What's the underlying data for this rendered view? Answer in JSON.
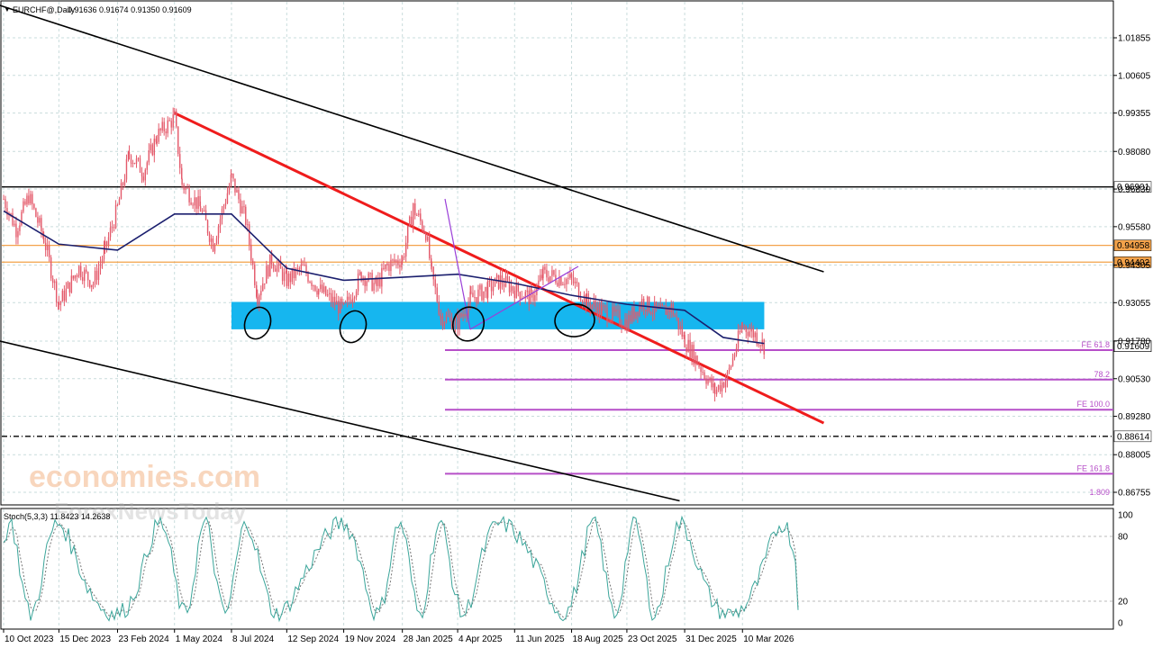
{
  "header": {
    "symbol": "EURCHF@,Daily",
    "ohlc": "0.91636 0.91674 0.91350 0.91609"
  },
  "osc_header": {
    "label": "Stoch(5,3,3) 11.8423 14.2638"
  },
  "watermark": {
    "brand": "economies.com",
    "sub": "ForexNewsToday"
  },
  "colors": {
    "candles": "#e45a6b",
    "ma": "#1b1f6e",
    "red_trend": "#ef1c1c",
    "channel": "#000000",
    "orange": "#f3a24a",
    "fib": "#b64fc8",
    "zone": "#16b6ef",
    "stoch_main": "#3aa59a",
    "stoch_signal": "#777777",
    "grid": "#c9dcdc",
    "price_tag_bg": "#000000"
  },
  "chart_data": {
    "type": "candlestick",
    "symbol": "EURCHF",
    "timeframe": "Daily",
    "price_axis": {
      "ticks": [
        "1.01855",
        "1.00605",
        "0.99355",
        "0.98080",
        "0.96830",
        "0.95580",
        "0.94305",
        "0.93055",
        "0.91780",
        "0.90530",
        "0.89280",
        "0.88005",
        "0.86755"
      ]
    },
    "time_axis": {
      "ticks": [
        "10 Oct 2023",
        "15 Dec 2023",
        "23 Feb 2024",
        "1 May 2024",
        "8 Jul 2024",
        "12 Sep 2024",
        "19 Nov 2024",
        "28 Jan 2025",
        "4 Apr 2025",
        "11 Jun 2025",
        "18 Aug 2025",
        "23 Oct 2025",
        "31 Dec 2025",
        "10 Mar 2026"
      ]
    },
    "price_series": [
      [
        "10 Oct 2023",
        0.965
      ],
      [
        "25 Oct 2023",
        0.955
      ],
      [
        "9 Nov 2023",
        0.966
      ],
      [
        "27 Nov 2023",
        0.952
      ],
      [
        "15 Dec 2023",
        0.93
      ],
      [
        "8 Jan 2024",
        0.942
      ],
      [
        "25 Jan 2024",
        0.937
      ],
      [
        "8 Feb 2024",
        0.948
      ],
      [
        "23 Feb 2024",
        0.962
      ],
      [
        "8 Mar 2024",
        0.98
      ],
      [
        "25 Mar 2024",
        0.974
      ],
      [
        "10 Apr 2024",
        0.986
      ],
      [
        "1 May 2024",
        0.992
      ],
      [
        "10 May 2024",
        0.97
      ],
      [
        "1 Jun 2024",
        0.962
      ],
      [
        "16 Jun 2024",
        0.95
      ],
      [
        "1 Jul 2024",
        0.965
      ],
      [
        "8 Jul 2024",
        0.972
      ],
      [
        "25 Jul 2024",
        0.958
      ],
      [
        "8 Aug 2024",
        0.933
      ],
      [
        "25 Aug 2024",
        0.945
      ],
      [
        "12 Sep 2024",
        0.938
      ],
      [
        "1 Oct 2024",
        0.942
      ],
      [
        "20 Oct 2024",
        0.935
      ],
      [
        "19 Nov 2024",
        0.928
      ],
      [
        "10 Dec 2024",
        0.94
      ],
      [
        "28 Dec 2024",
        0.936
      ],
      [
        "10 Jan 2025",
        0.943
      ],
      [
        "28 Jan 2025",
        0.945
      ],
      [
        "10 Feb 2025",
        0.962
      ],
      [
        "25 Feb 2025",
        0.954
      ],
      [
        "4 Mar 2025",
        0.94
      ],
      [
        "15 Mar 2025",
        0.926
      ],
      [
        "4 Apr 2025",
        0.924
      ],
      [
        "20 Apr 2025",
        0.932
      ],
      [
        "10 May 2025",
        0.935
      ],
      [
        "25 May 2025",
        0.938
      ],
      [
        "11 Jun 2025",
        0.935
      ],
      [
        "1 Jul 2025",
        0.932
      ],
      [
        "15 Jul 2025",
        0.94
      ],
      [
        "18 Aug 2025",
        0.938
      ],
      [
        "5 Sep 2025",
        0.931
      ],
      [
        "23 Sep 2025",
        0.928
      ],
      [
        "23 Oct 2025",
        0.924
      ],
      [
        "10 Nov 2025",
        0.931
      ],
      [
        "30 Nov 2025",
        0.927
      ],
      [
        "15 Dec 2025",
        0.929
      ],
      [
        "31 Dec 2025",
        0.918
      ],
      [
        "15 Jan 2026",
        0.911
      ],
      [
        "5 Feb 2026",
        0.901
      ],
      [
        "20 Feb 2026",
        0.906
      ],
      [
        "10 Mar 2026",
        0.923
      ],
      [
        "25 Mar 2026",
        0.92
      ],
      [
        "5 Apr 2026",
        0.9161
      ]
    ],
    "moving_average": [
      [
        "10 Oct 2023",
        0.961
      ],
      [
        "15 Dec 2023",
        0.95
      ],
      [
        "23 Feb 2024",
        0.948
      ],
      [
        "1 May 2024",
        0.96
      ],
      [
        "8 Jul 2024",
        0.96
      ],
      [
        "12 Sep 2024",
        0.942
      ],
      [
        "19 Nov 2024",
        0.938
      ],
      [
        "28 Jan 2025",
        0.939
      ],
      [
        "4 Apr 2025",
        0.94
      ],
      [
        "11 Jun 2025",
        0.937
      ],
      [
        "18 Aug 2025",
        0.933
      ],
      [
        "23 Oct 2025",
        0.93
      ],
      [
        "31 Dec 2025",
        0.928
      ],
      [
        "15 Feb 2026",
        0.919
      ],
      [
        "10 Mar 2026",
        0.918
      ],
      [
        "5 Apr 2026",
        0.917
      ]
    ],
    "current_price": "0.91609",
    "horizontal_levels": [
      {
        "label": "0.96901",
        "price": 0.96901,
        "style": "solid",
        "color": "#000000"
      },
      {
        "label": "0.94958",
        "price": 0.94958,
        "style": "solid",
        "color": "#f3a24a"
      },
      {
        "label": "0.94402",
        "price": 0.94402,
        "style": "solid",
        "color": "#f3a24a"
      },
      {
        "label": "0.88614",
        "price": 0.88614,
        "style": "dashdot",
        "color": "#000000"
      }
    ],
    "fib_levels": [
      {
        "label": "FE 61.8",
        "price": 0.9148
      },
      {
        "label": "78.2",
        "price": 0.905
      },
      {
        "label": "FE 100.0",
        "price": 0.895
      },
      {
        "label": "FE 161.8",
        "price": 0.8737
      },
      {
        "label": "1.809",
        "price": 0.8658
      }
    ],
    "support_zone": {
      "from_date": "8 Jul 2024",
      "to_date": "5 Apr 2026",
      "low": 0.9217,
      "high": 0.9308
    },
    "trendlines": [
      {
        "name": "red resistance",
        "from": [
          "1 May 2024",
          0.99355
        ],
        "to": [
          "15 Jun 2026",
          0.89055
        ]
      },
      {
        "name": "upper channel",
        "from": [
          "1 Jul 2023",
          1.038
        ],
        "to": [
          "15 Jun 2026",
          0.9408
        ]
      },
      {
        "name": "lower channel",
        "from": [
          "1 Jul 2023",
          0.9241
        ],
        "to": [
          "25 Dec 2025",
          0.8647
        ]
      }
    ],
    "stochastic": {
      "name": "Stoch(5,3,3)",
      "main": 11.8423,
      "signal": 14.2638,
      "ticks": [
        "100",
        "80",
        "20",
        "0"
      ]
    }
  }
}
